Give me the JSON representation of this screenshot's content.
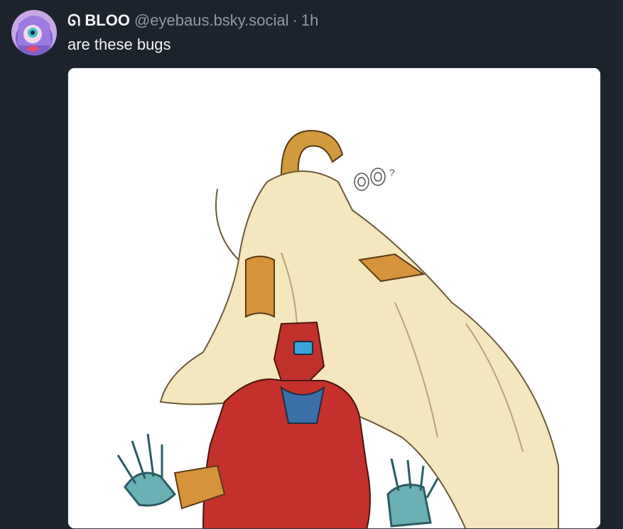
{
  "post": {
    "author_glyph": "ᘏ",
    "display_name": "BLOO",
    "handle": "@eyebaus.bsky.social",
    "separator": "·",
    "timestamp": "1h",
    "text": "are these bugs"
  },
  "media": {
    "sketch_text": "?"
  },
  "colors": {
    "background": "#1c232c",
    "primary_text": "#f1f3f5",
    "secondary_text": "#8d9aab"
  }
}
